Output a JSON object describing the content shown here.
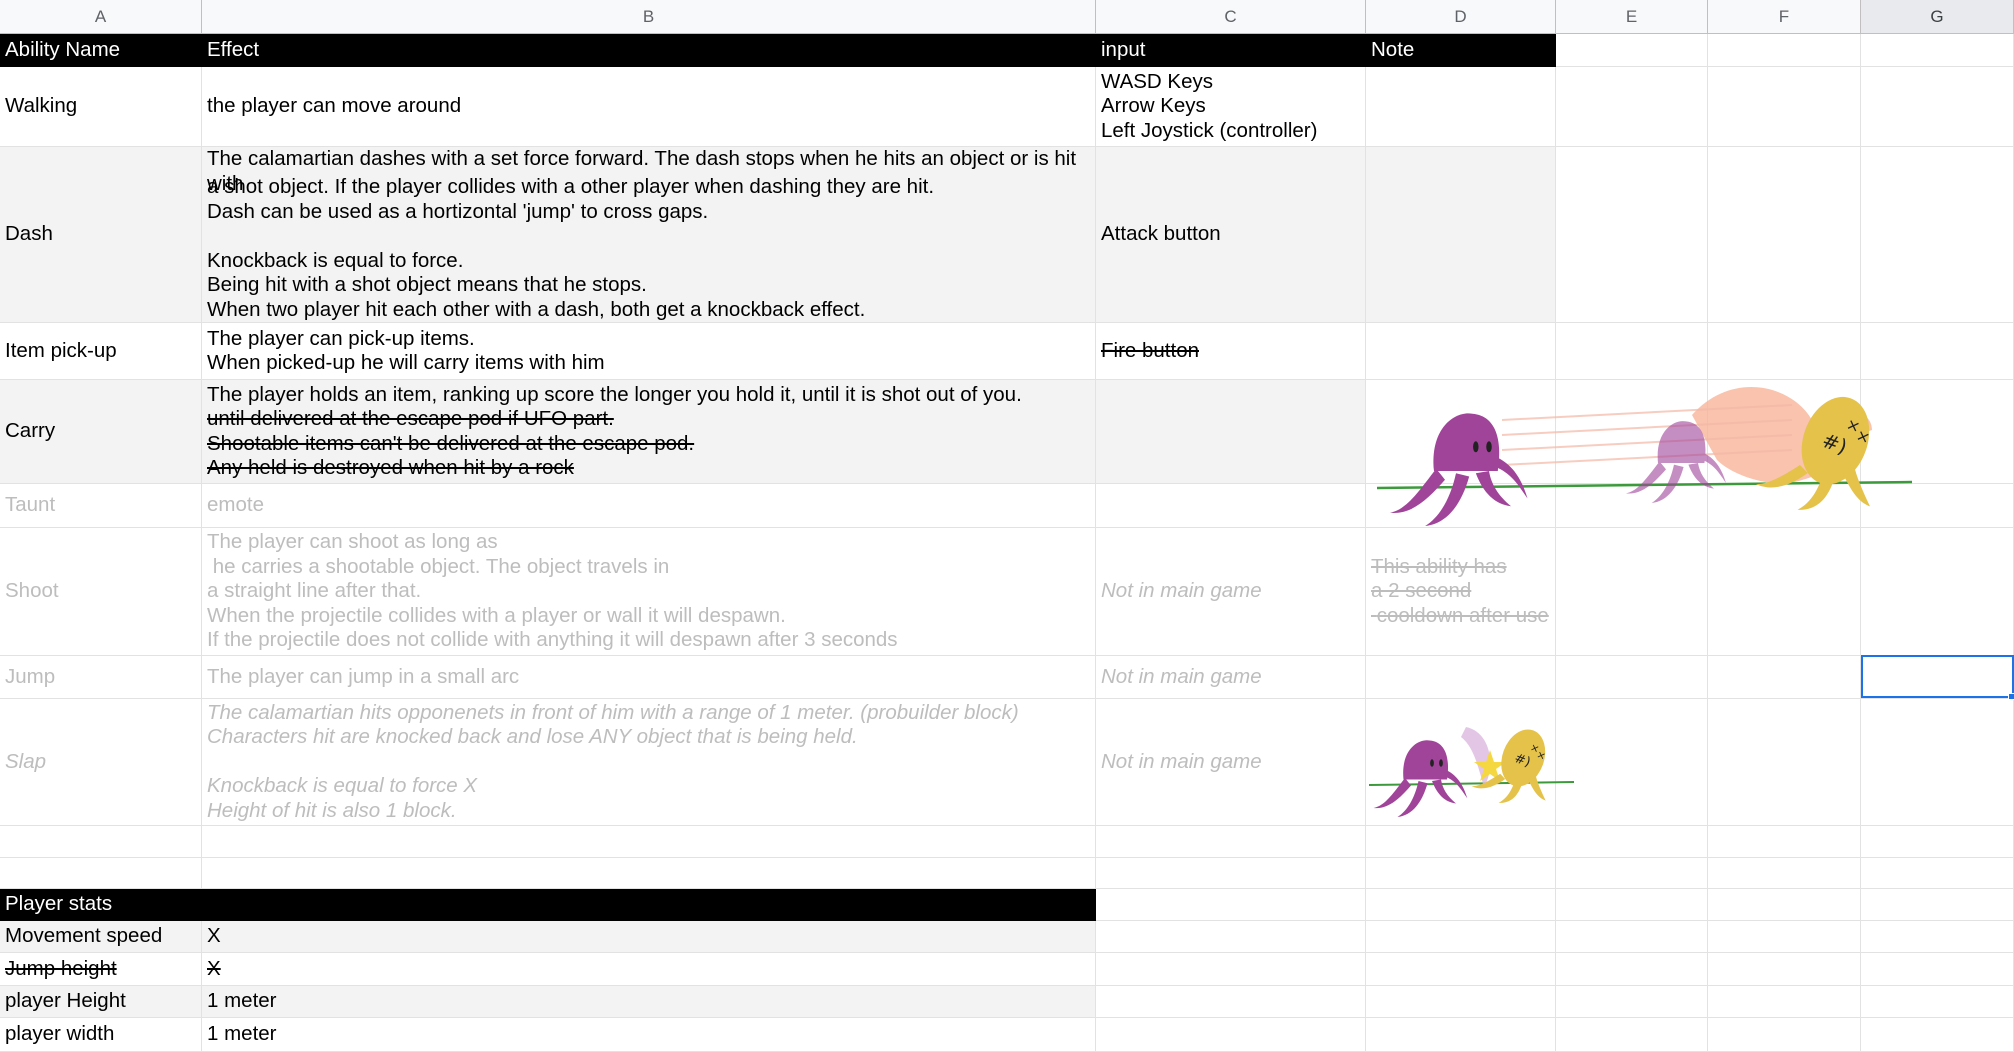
{
  "columns": [
    "A",
    "B",
    "C",
    "D",
    "E",
    "F",
    "G"
  ],
  "abilities_header": {
    "name": "Ability Name",
    "effect": "Effect",
    "input": "input",
    "note": "Note"
  },
  "abilities": [
    {
      "name": "Walking",
      "effect": [
        "the player can move around"
      ],
      "input": [
        "WASD Keys",
        "Arrow Keys",
        "Left Joystick (controller)"
      ],
      "note": []
    },
    {
      "name": "Dash",
      "effect": [
        "The calamartian dashes with a set force forward. The dash stops when he hits an object or is hit with",
        "a shot object. If the player collides with a other player when dashing they are hit.",
        "Dash can be used as a hortizontal 'jump' to cross gaps.",
        "",
        "Knockback is equal to force.",
        "Being hit with a shot object means that he stops.",
        "When two player hit each other with a dash, both get a knockback effect."
      ],
      "input": [
        "Attack button"
      ],
      "note": []
    },
    {
      "name": "Item pick-up",
      "effect": [
        "The player can pick-up items.",
        "When picked-up he will carry items with him"
      ],
      "input": [
        "Fire button"
      ],
      "note": []
    },
    {
      "name": "Carry",
      "effect": [
        "The player holds an item, ranking up score the longer you hold it, until it is shot out of you.",
        "until delivered at the escape pod if UFO part.",
        "Shootable items can't be delivered at the escape pod.",
        "Any held is destroyed when hit by a rock"
      ],
      "input": [],
      "note": []
    },
    {
      "name": "Taunt",
      "effect": [
        "emote"
      ],
      "input": [],
      "note": []
    },
    {
      "name": "Shoot",
      "effect": [
        "The player can shoot as long as",
        " he carries a shootable object. The object travels in",
        "a straight line after that.",
        "When the projectile collides with a player or wall it will despawn.",
        "If the projectile does not collide with anything it will despawn after 3 seconds"
      ],
      "input": [
        "Not in main game"
      ],
      "note": [
        "This ability has",
        "a 2 second",
        " cooldown after use"
      ]
    },
    {
      "name": "Jump",
      "effect": [
        "The player can jump in a small arc"
      ],
      "input": [
        "Not in main game"
      ],
      "note": []
    },
    {
      "name": "Slap",
      "effect": [
        "The calamartian hits opponenets in front of him with a range of 1 meter. (probuilder block)",
        "Characters hit are knocked back and lose ANY object that is being held.",
        "",
        "Knockback is equal to force X",
        "Height of hit is also 1 block."
      ],
      "input": [
        "Not in main game"
      ],
      "note": []
    }
  ],
  "stats_header": "Player stats",
  "stats": [
    {
      "label": "Movement speed",
      "value": "X"
    },
    {
      "label": "Jump height",
      "value": "X"
    },
    {
      "label": "player Height",
      "value": "1 meter"
    },
    {
      "label": "player width",
      "value": "1 meter"
    }
  ],
  "colors": {
    "header_bg": "#000000",
    "gray_row": "#f3f3f3",
    "selection": "#1a73e8",
    "octopus_purple": "#a0449a",
    "octopus_yellow": "#e5c24a"
  },
  "images": [
    "dash-illustration",
    "slap-illustration"
  ]
}
